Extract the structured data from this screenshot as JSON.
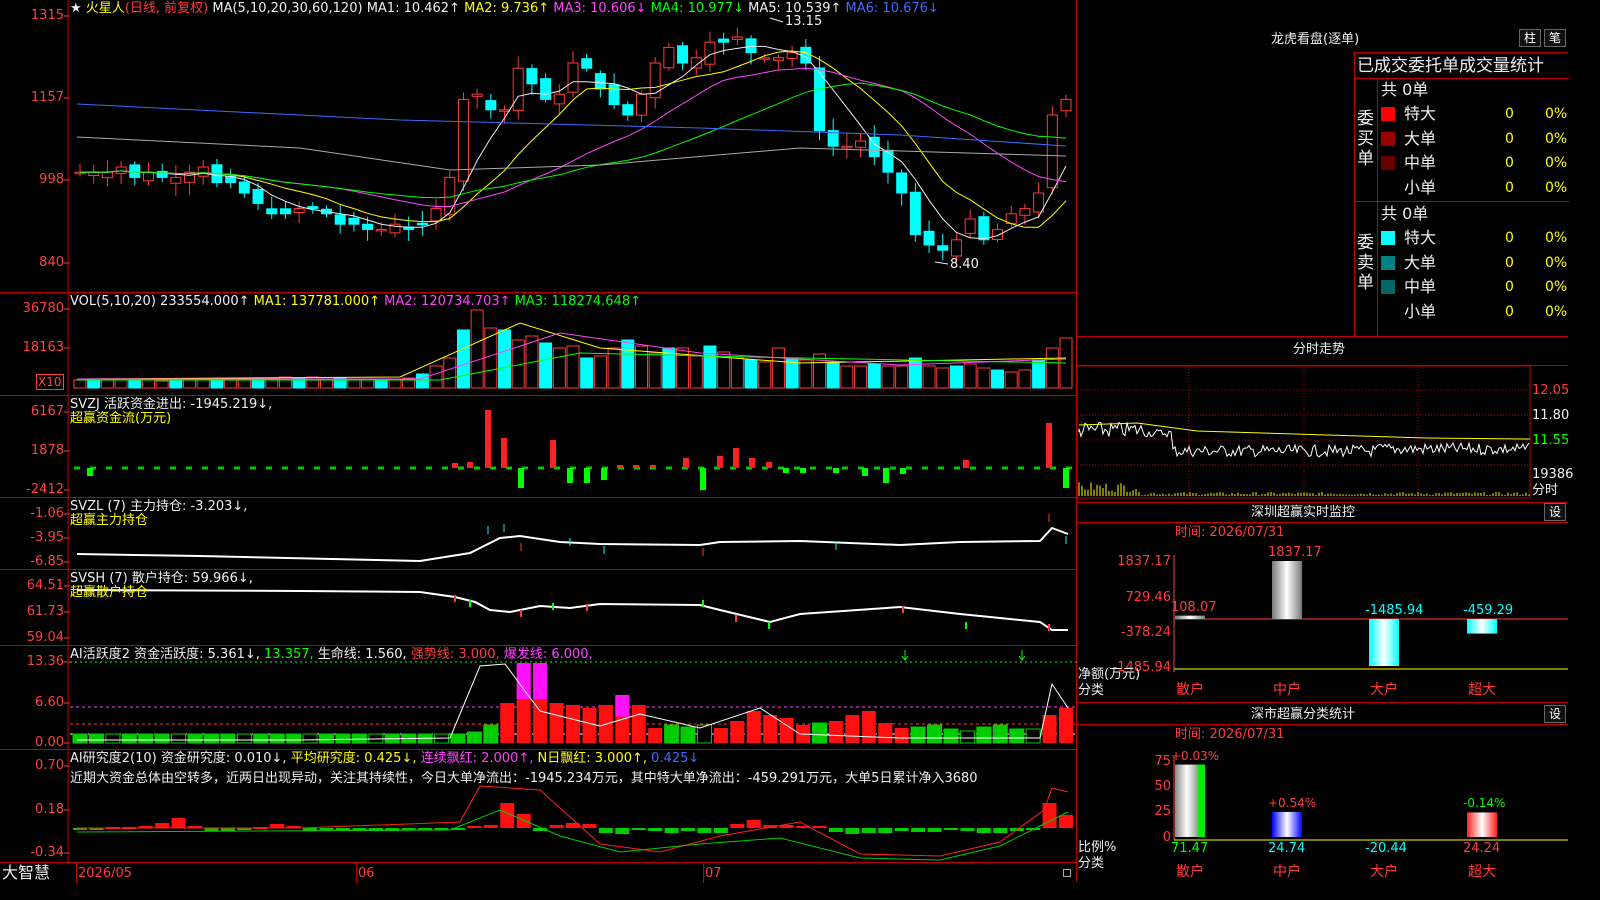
{
  "app": {
    "brand": "大智慧",
    "chart_mode_bar": "柱",
    "chart_mode_pen": "笔"
  },
  "stock": {
    "name": "火星人",
    "mode": "(日线, 前复权)",
    "ma_params": "MA(5,10,20,30,60,120)"
  },
  "main_legend": [
    {
      "label": "MA1: 10.462↑",
      "color": "#eeeeee"
    },
    {
      "label": "MA2: 9.736↑",
      "color": "#ffff00"
    },
    {
      "label": "MA3: 10.606↓",
      "color": "#ff44ff"
    },
    {
      "label": "MA4: 10.977↓",
      "color": "#00ff00"
    },
    {
      "label": "MA5: 10.539↑",
      "color": "#eeeeee"
    },
    {
      "label": "MA6: 10.676↓",
      "color": "#3f6bff"
    }
  ],
  "main_y_labels": [
    "1315",
    "1157",
    "998",
    "840"
  ],
  "main_annotations": {
    "high": "13.15",
    "low": "8.40"
  },
  "vol_panel": {
    "title": "VOL(5,10,20)",
    "value": "233554.000↑",
    "ma1": "MA1: 137781.000↑",
    "ma2": "MA2: 120734.703↑",
    "ma3": "MA3: 118274.648↑",
    "y_labels": [
      "36780",
      "18163"
    ],
    "unit": "X10"
  },
  "svzj_panel": {
    "title": "SVZJ  活跃资金进出: -1945.219↓,",
    "subtitle": "超赢资金流(万元)",
    "y_labels": [
      "6167",
      "1878",
      "-2412"
    ]
  },
  "svzl_panel": {
    "title": "SVZL (7) 主力持仓: -3.203↓,",
    "subtitle": "超赢主力持仓",
    "y_labels": [
      "-1.06",
      "-3.95",
      "-6.85"
    ]
  },
  "svsh_panel": {
    "title": "SVSH (7) 散户持仓: 59.966↓,",
    "subtitle": "超赢散户持仓",
    "y_labels": [
      "64.51",
      "61.73",
      "59.04"
    ]
  },
  "ai1_panel": {
    "title": "AI活跃度2 资金活跃度: 5.361↓,",
    "v2": "13.357,",
    "v3": "生命线: 1.560,",
    "v4": "强势线: 3.000,",
    "v5": "爆发线: 6.000,",
    "y_labels": [
      "13.36",
      "6.60",
      "0.00"
    ]
  },
  "ai2_panel": {
    "title": "AI研究度2(10) 资金研究度: 0.010↓,",
    "v2": "平均研究度: 0.425↓,",
    "v3": "连续飘红: 2.000↑,",
    "v4": "N日飘红: 3.000↑,",
    "v5": "0.425↓",
    "comment": "近期大资金总体由空转多，近两日出现异动，关注其持续性，今日大单净流出：-1945.234万元，其中特大单净流出：-459.291万元，大单5日累计净入3680",
    "y_labels": [
      "0.70",
      "0.18",
      "-0.34"
    ]
  },
  "x_axis": [
    "2026/05",
    "06",
    "07"
  ],
  "longhu": {
    "title": "龙虎看盘(逐单)",
    "header": "已成交委托单成交量统计",
    "buy": {
      "side_label": "委买单",
      "total": "共 0单",
      "rows": [
        {
          "label": "特大",
          "count": "0",
          "pct": "0%",
          "color": "#ff0000"
        },
        {
          "label": "大单",
          "count": "0",
          "pct": "0%",
          "color": "#990000"
        },
        {
          "label": "中单",
          "count": "0",
          "pct": "0%",
          "color": "#660000"
        },
        {
          "label": "小单",
          "count": "0",
          "pct": "0%",
          "color": ""
        }
      ]
    },
    "sell": {
      "side_label": "委卖单",
      "total": "共 0单",
      "rows": [
        {
          "label": "特大",
          "count": "0",
          "pct": "0%",
          "color": "#00ffff"
        },
        {
          "label": "大单",
          "count": "0",
          "pct": "0%",
          "color": "#008080"
        },
        {
          "label": "中单",
          "count": "0",
          "pct": "0%",
          "color": "#006666"
        },
        {
          "label": "小单",
          "count": "0",
          "pct": "0%",
          "color": ""
        }
      ]
    }
  },
  "intraday": {
    "title": "分时走势",
    "y_labels": [
      "12.05",
      "11.80",
      "11.55"
    ],
    "vol_label": "19386",
    "bottom_label": "分时"
  },
  "monitor": {
    "title": "深圳超赢实时监控",
    "set": "设",
    "time": "时间: 2026/07/31",
    "y_labels": [
      "1837.17",
      "729.46",
      "-378.24",
      "-1485.94"
    ],
    "axis_label": "净额(万元)",
    "axis_label2": "分类",
    "categories": [
      "散户",
      "中户",
      "大户",
      "超大"
    ],
    "values": [
      "108.07",
      "1837.17",
      "-1485.94",
      "-459.29"
    ]
  },
  "stats": {
    "title": "深市超赢分类统计",
    "set": "设",
    "time": "时间: 2026/07/31",
    "y_labels": [
      "75",
      "50",
      "25",
      "0"
    ],
    "axis_label": "比例%",
    "axis_label2": "分类",
    "categories": [
      "散户",
      "中户",
      "大户",
      "超大"
    ],
    "top_pct": [
      "+0.03%",
      "+0.54%",
      "",
      "-0.14%"
    ],
    "values": [
      "71.47",
      "24.74",
      "-20.44",
      "24.24"
    ]
  },
  "chart_data": [
    {
      "type": "bar",
      "title": "深圳超赢实时监控",
      "ylabel": "净额(万元)",
      "categories": [
        "散户",
        "中户",
        "大户",
        "超大"
      ],
      "values": [
        108.07,
        1837.17,
        -1485.94,
        -459.29
      ],
      "ylim": [
        -1485.94,
        1837.17
      ]
    },
    {
      "type": "bar",
      "title": "深市超赢分类统计",
      "ylabel": "比例%",
      "categories": [
        "散户",
        "中户",
        "大户",
        "超大"
      ],
      "values": [
        71.47,
        24.74,
        -20.44,
        24.24
      ],
      "ylim": [
        0,
        75
      ]
    }
  ]
}
